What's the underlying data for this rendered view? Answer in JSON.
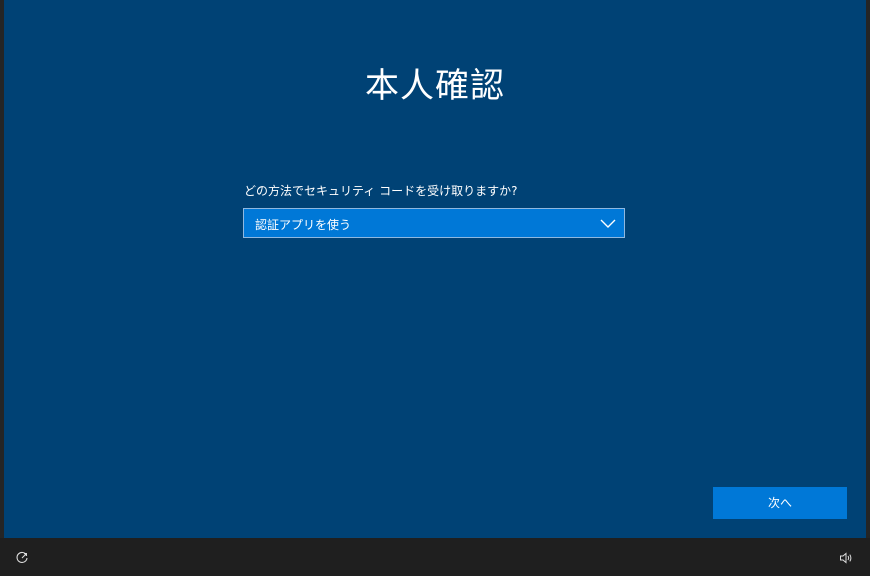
{
  "page": {
    "title": "本人確認",
    "prompt": "どの方法でセキュリティ コードを受け取りますか?"
  },
  "method_select": {
    "selected": "認証アプリを使う"
  },
  "actions": {
    "next_label": "次へ"
  },
  "taskbar": {
    "left_icon": "ease-of-access-icon",
    "right_icon": "volume-icon"
  },
  "colors": {
    "panel_bg": "#004275",
    "accent": "#0078d7",
    "taskbar_bg": "#1f1f1f"
  }
}
